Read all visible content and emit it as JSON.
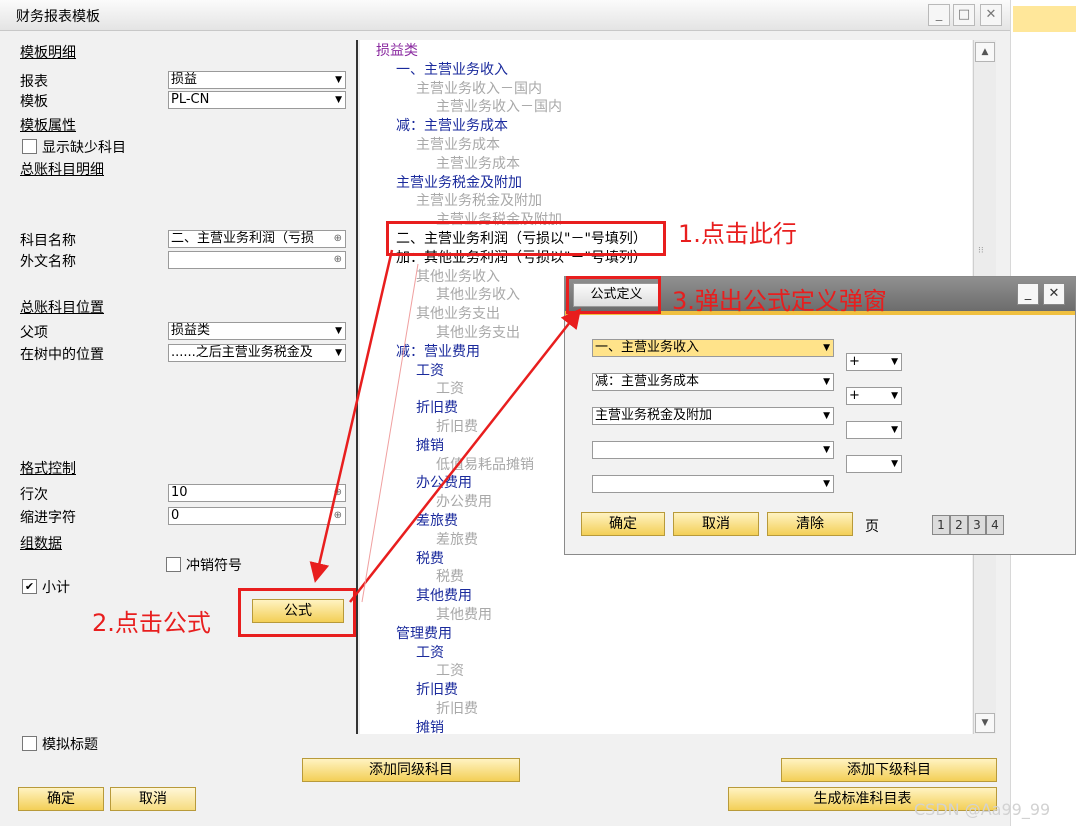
{
  "window": {
    "title": "财务报表模板"
  },
  "left": {
    "template_detail": "模板明细",
    "report_label": "报表",
    "report_value": "损益",
    "template_label": "模板",
    "template_value": "PL-CN",
    "template_props": "模板属性",
    "show_missing": "显示缺少科目",
    "gl_detail": "总账科目明细",
    "account_name_label": "科目名称",
    "account_name_value": "二、主营业务利润（亏损",
    "foreign_name_label": "外文名称",
    "foreign_name_value": "",
    "gl_position": "总账科目位置",
    "parent_label": "父项",
    "parent_value": "损益类",
    "tree_pos_label": "在树中的位置",
    "tree_pos_value": "......之后主营业务税金及",
    "format_control": "格式控制",
    "row_label": "行次",
    "row_value": "10",
    "indent_label": "缩进字符",
    "indent_value": "0",
    "group_data": "组数据",
    "reverse_sign": "冲销符号",
    "subtotal": "小计",
    "formula_btn": "公式",
    "dummy_title": "模拟标题",
    "ok_btn": "确定",
    "cancel_btn": "取消"
  },
  "tree": [
    {
      "text": "损益类",
      "level": 0,
      "style": "purple"
    },
    {
      "text": "一、主营业务收入",
      "level": 1,
      "style": "blue"
    },
    {
      "text": "主营业务收入－国内",
      "level": 2,
      "style": "gray"
    },
    {
      "text": "主营业务收入－国内",
      "level": 3,
      "style": "gray"
    },
    {
      "text": "减：主营业务成本",
      "level": 1,
      "style": "blue"
    },
    {
      "text": "主营业务成本",
      "level": 2,
      "style": "gray"
    },
    {
      "text": "主营业务成本",
      "level": 3,
      "style": "gray"
    },
    {
      "text": "主营业务税金及附加",
      "level": 1,
      "style": "blue"
    },
    {
      "text": "主营业务税金及附加",
      "level": 2,
      "style": "gray"
    },
    {
      "text": "主营业务税金及附加",
      "level": 3,
      "style": "gray"
    },
    {
      "text": "二、主营业务利润（亏损以\"－\"号填列）",
      "level": 1,
      "style": "black"
    },
    {
      "text": "加：其他业务利润（亏损以\"－\"号填列）",
      "level": 1,
      "style": "black"
    },
    {
      "text": "其他业务收入",
      "level": 2,
      "style": "gray"
    },
    {
      "text": "其他业务收入",
      "level": 3,
      "style": "gray"
    },
    {
      "text": "其他业务支出",
      "level": 2,
      "style": "gray"
    },
    {
      "text": "其他业务支出",
      "level": 3,
      "style": "gray"
    },
    {
      "text": "减：营业费用",
      "level": 1,
      "style": "blue"
    },
    {
      "text": "工资",
      "level": 2,
      "style": "blue"
    },
    {
      "text": "工资",
      "level": 3,
      "style": "gray"
    },
    {
      "text": "折旧费",
      "level": 2,
      "style": "blue"
    },
    {
      "text": "折旧费",
      "level": 3,
      "style": "gray"
    },
    {
      "text": "摊销",
      "level": 2,
      "style": "blue"
    },
    {
      "text": "低值易耗品摊销",
      "level": 3,
      "style": "gray"
    },
    {
      "text": "办公费用",
      "level": 2,
      "style": "blue"
    },
    {
      "text": "办公费用",
      "level": 3,
      "style": "gray"
    },
    {
      "text": "差旅费",
      "level": 2,
      "style": "blue"
    },
    {
      "text": "差旅费",
      "level": 3,
      "style": "gray"
    },
    {
      "text": "税费",
      "level": 2,
      "style": "blue"
    },
    {
      "text": "税费",
      "level": 3,
      "style": "gray"
    },
    {
      "text": "其他费用",
      "level": 2,
      "style": "blue"
    },
    {
      "text": "其他费用",
      "level": 3,
      "style": "gray"
    },
    {
      "text": "管理费用",
      "level": 1,
      "style": "blue"
    },
    {
      "text": "工资",
      "level": 2,
      "style": "blue"
    },
    {
      "text": "工资",
      "level": 3,
      "style": "gray"
    },
    {
      "text": "折旧费",
      "level": 2,
      "style": "blue"
    },
    {
      "text": "折旧费",
      "level": 3,
      "style": "gray"
    },
    {
      "text": "摊销",
      "level": 2,
      "style": "blue"
    }
  ],
  "bottom": {
    "add_sibling": "添加同级科目",
    "add_child": "添加下级科目",
    "gen_standard": "生成标准科目表"
  },
  "popup": {
    "title": "公式定义",
    "formula_rows": [
      "一、主营业务收入",
      "减：主营业务成本",
      "主营业务税金及附加",
      "",
      ""
    ],
    "operators": [
      "+",
      "+",
      "",
      ""
    ],
    "ok": "确定",
    "cancel": "取消",
    "clear": "清除",
    "page_label": "页",
    "pages": [
      "1",
      "2",
      "3",
      "4"
    ]
  },
  "annotations": {
    "step1": "1.点击此行",
    "step2": "2.点击公式",
    "step3": "3.弹出公式定义弹窗"
  },
  "watermark": "CSDN @Aa99_99",
  "colors": {
    "accent": "#f3cf57",
    "annotation": "#e81e1e",
    "highlight": "#ffdc7a"
  }
}
